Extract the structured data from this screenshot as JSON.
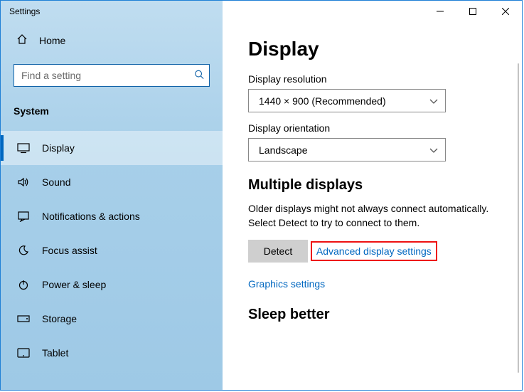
{
  "window": {
    "title": "Settings"
  },
  "sidebar": {
    "home": "Home",
    "search_placeholder": "Find a setting",
    "category": "System",
    "items": [
      {
        "label": "Display",
        "icon": "monitor"
      },
      {
        "label": "Sound",
        "icon": "sound"
      },
      {
        "label": "Notifications & actions",
        "icon": "notifications"
      },
      {
        "label": "Focus assist",
        "icon": "moon"
      },
      {
        "label": "Power & sleep",
        "icon": "power"
      },
      {
        "label": "Storage",
        "icon": "storage"
      },
      {
        "label": "Tablet",
        "icon": "tablet"
      }
    ],
    "selected_index": 0
  },
  "content": {
    "heading": "Display",
    "resolution": {
      "label": "Display resolution",
      "value": "1440 × 900 (Recommended)"
    },
    "orientation": {
      "label": "Display orientation",
      "value": "Landscape"
    },
    "multiple": {
      "heading": "Multiple displays",
      "desc": "Older displays might not always connect automatically. Select Detect to try to connect to them.",
      "detect": "Detect"
    },
    "links": {
      "advanced": "Advanced display settings",
      "graphics": "Graphics settings"
    },
    "sleep_heading": "Sleep better"
  }
}
